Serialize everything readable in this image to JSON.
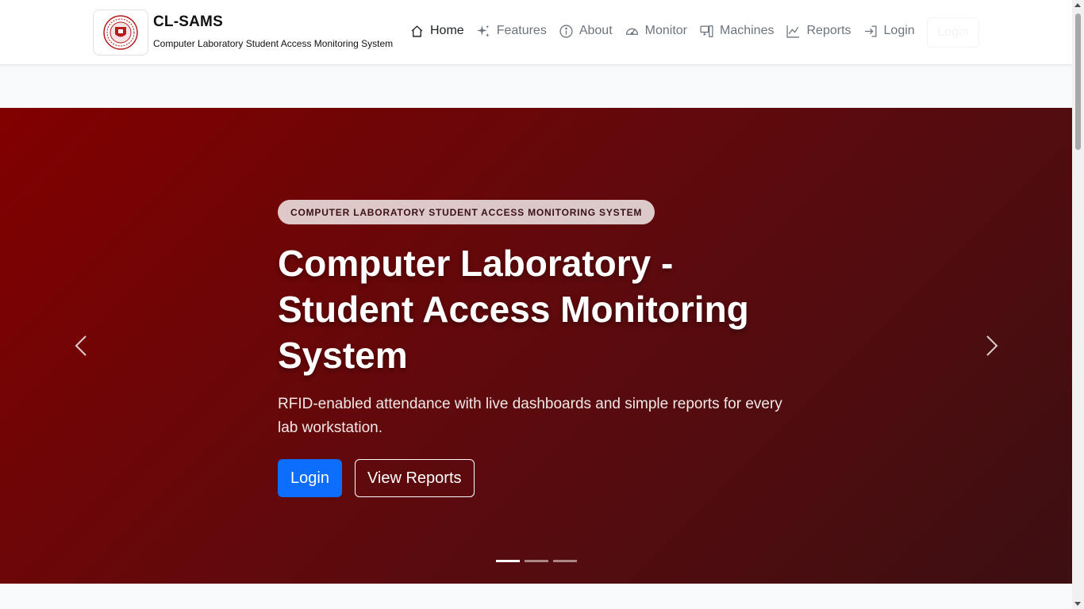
{
  "brand": {
    "title": "CL-SAMS",
    "subtitle": "Computer Laboratory Student Access Monitoring System",
    "logo_icon": "university-seal-logo"
  },
  "nav": {
    "items": [
      {
        "label": "Home",
        "icon": "house-icon",
        "active": true
      },
      {
        "label": "Features",
        "icon": "sparkles-icon",
        "active": false
      },
      {
        "label": "About",
        "icon": "info-circle-icon",
        "active": false
      },
      {
        "label": "Monitor",
        "icon": "speedometer-icon",
        "active": false
      },
      {
        "label": "Machines",
        "icon": "pc-display-icon",
        "active": false
      },
      {
        "label": "Reports",
        "icon": "line-chart-icon",
        "active": false
      },
      {
        "label": "Login",
        "icon": "login-arrow-icon",
        "active": false
      }
    ],
    "ghost_button_label": "Login"
  },
  "hero": {
    "badge": "COMPUTER LABORATORY STUDENT ACCESS MONITORING SYSTEM",
    "title": "Computer Laboratory - Student Access Monitoring System",
    "subtitle": "RFID-enabled attendance with live dashboards and simple reports for every lab workstation.",
    "primary_button": "Login",
    "secondary_button": "View Reports",
    "slide_count": 3,
    "active_slide": 1
  },
  "colors": {
    "hero_start": "#820000",
    "hero_end": "#3c0f12",
    "primary": "#0d6efd",
    "nav_active": "#212529",
    "nav_muted": "#6c757d"
  }
}
